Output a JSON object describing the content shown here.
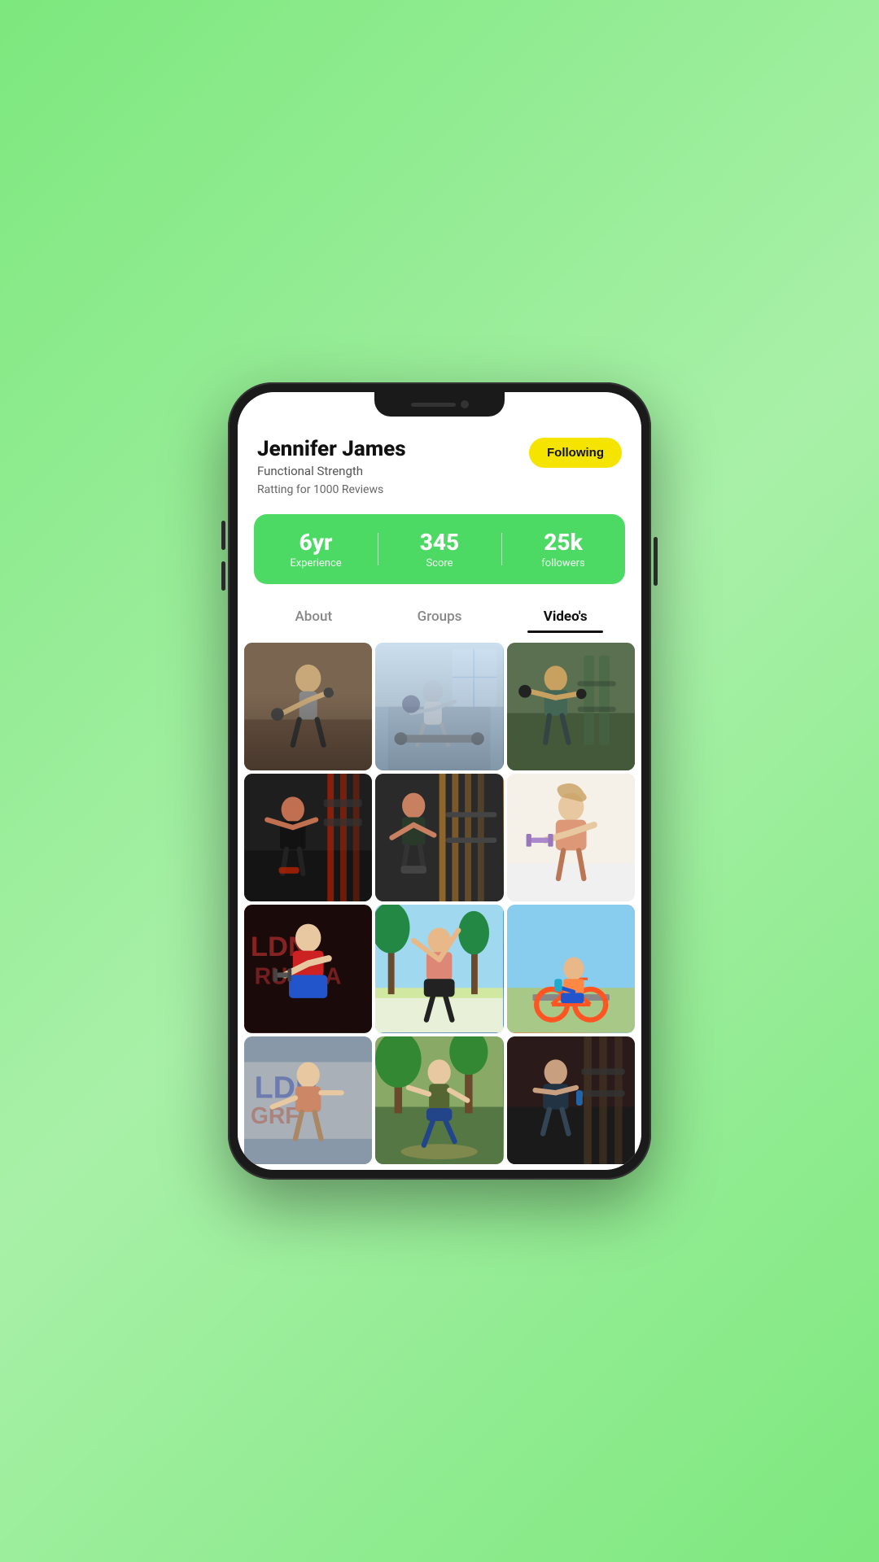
{
  "background": "#7de87d",
  "profile": {
    "name": "Jennifer James",
    "specialty": "Functional Strength",
    "rating_text": "Ratting for 1000 Reviews",
    "following_label": "Following"
  },
  "stats": [
    {
      "value": "6yr",
      "label": "Experience"
    },
    {
      "value": "345",
      "label": "Score"
    },
    {
      "value": "25k",
      "label": "followers"
    }
  ],
  "tabs": [
    {
      "id": "about",
      "label": "About",
      "active": false
    },
    {
      "id": "groups",
      "label": "Groups",
      "active": false
    },
    {
      "id": "videos",
      "label": "Video's",
      "active": true
    }
  ],
  "videos": {
    "count": 12,
    "items": [
      {
        "id": 1,
        "class": "img-1"
      },
      {
        "id": 2,
        "class": "img-2"
      },
      {
        "id": 3,
        "class": "img-3"
      },
      {
        "id": 4,
        "class": "img-4"
      },
      {
        "id": 5,
        "class": "img-5"
      },
      {
        "id": 6,
        "class": "img-6"
      },
      {
        "id": 7,
        "class": "img-7"
      },
      {
        "id": 8,
        "class": "img-8"
      },
      {
        "id": 9,
        "class": "img-9"
      },
      {
        "id": 10,
        "class": "img-10"
      },
      {
        "id": 11,
        "class": "img-11"
      },
      {
        "id": 12,
        "class": "img-12"
      }
    ]
  }
}
